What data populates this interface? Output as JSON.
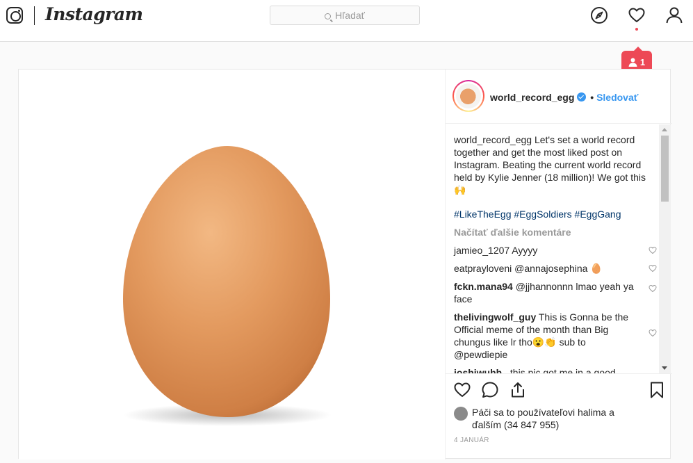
{
  "header": {
    "wordmark": "Instagram",
    "search_placeholder": "Hľadať",
    "notification_count": "1",
    "accent_color": "#ed4956"
  },
  "post": {
    "username": "world_record_egg",
    "separator": "•",
    "follow_label": "Sledovať",
    "caption_user": "world_record_egg",
    "caption_text": "Let's set a world record together and get the most liked post on Instagram. Beating the current world record held by Kylie Jenner (18 million)! We got this 🙌",
    "hashtags": "#LikeTheEgg #EggSoldiers #EggGang",
    "load_more": "Načítať ďalšie komentáre",
    "comments": [
      {
        "user": "jamieo_1207",
        "text": "Ayyyy"
      },
      {
        "user": "eatprayloveni",
        "text": "@annajosephina 🥚"
      },
      {
        "user": "fckn.mana94",
        "text": "@jjhannonnn lmao yeah ya face"
      },
      {
        "user": "thelivingwolf_guy",
        "text": "This is Gonna be the Official meme of the month than Big chungus like lr tho😮👏 sub to @pewdiepie"
      },
      {
        "user": "joshiwuhh_",
        "text": "this pic got me in a good mood all year when you scroll past it"
      }
    ],
    "likes_text": "Páči sa to používateľovi halima a ďalším (34 847 955)",
    "date": "4 JANUÁR"
  }
}
